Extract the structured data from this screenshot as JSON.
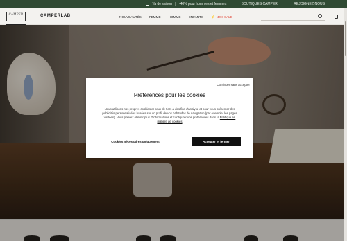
{
  "topbar": {
    "promo_text": "Ya de saison",
    "promo_link": "-40% pour hommes et femmes",
    "links": [
      "BOUTIQUES CAMPER",
      "REJOIGNEZ-NOUS"
    ]
  },
  "header": {
    "logo_text": "CAMPER",
    "brand_text": "CAMPERLAB",
    "nav": [
      "NOUVEAUTÉS",
      "FEMME",
      "HOMME",
      "ENFANTS"
    ],
    "nav_sale": "⚡ -40% SALE",
    "search": {
      "placeholder": ""
    }
  },
  "modal": {
    "continue_label": "Continuer sans accepter",
    "title": "Préférences pour les cookies",
    "body_text": "Nous utilisons nos propres cookies et ceux de tiers à des fins d'analyse et pour vous présenter des publicités personnalisées basées sur un profil de vos habitudes de navigation (par exemple, les pages visitées). Vous pouvez obtenir plus d'informations et configurer vos préférences dans la ",
    "policy_link": "Politique en matière de cookies",
    "btn_necessary": "Cookies nécessaires uniquement",
    "btn_accept": "Accepter et fermer"
  },
  "colors": {
    "topbar_bg": "#2f4a33",
    "sale": "#e03a2a",
    "accept_bg": "#111111"
  },
  "icons": [
    "ship-icon",
    "search-icon",
    "bag-icon"
  ]
}
